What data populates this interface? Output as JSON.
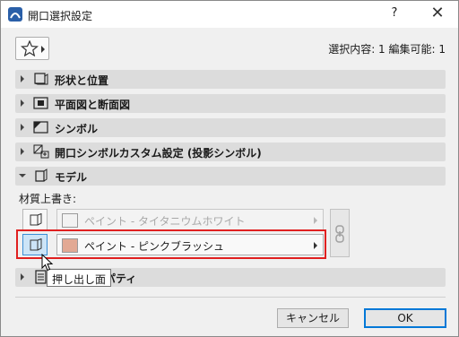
{
  "window": {
    "title": "開口選択設定",
    "help_label": "?",
    "close_label": "✕",
    "app_icon": "archicad-icon"
  },
  "toolbar": {
    "favorites_icon": "star-icon",
    "selection_info": "選択内容: 1 編集可能: 1"
  },
  "panels": [
    {
      "label": "形状と位置",
      "icon": "shape-position-icon",
      "expanded": false
    },
    {
      "label": "平面図と断面図",
      "icon": "floor-plan-section-icon",
      "expanded": false
    },
    {
      "label": "シンボル",
      "icon": "symbol-icon",
      "expanded": false
    },
    {
      "label": "開口シンボルカスタム設定 (投影シンボル)",
      "icon": "opening-symbol-custom-icon",
      "expanded": false
    },
    {
      "label": "モデル",
      "icon": "model-icon",
      "expanded": true
    },
    {
      "label": "パティ",
      "icon": "properties-icon",
      "expanded": false
    }
  ],
  "model": {
    "surface_override_label": "材質上書き:",
    "rows": [
      {
        "material": "ペイント - タイタニウムホワイト",
        "swatch_color": "#f2f2f2",
        "enabled": false
      },
      {
        "material": "ペイント - ピンクブラッシュ",
        "swatch_color": "#e2a994",
        "enabled": true
      }
    ]
  },
  "tooltip": "押し出し面",
  "buttons": {
    "cancel": "キャンセル",
    "ok": "OK"
  },
  "colors": {
    "highlight": "#e02020",
    "accent": "#0078d7"
  }
}
